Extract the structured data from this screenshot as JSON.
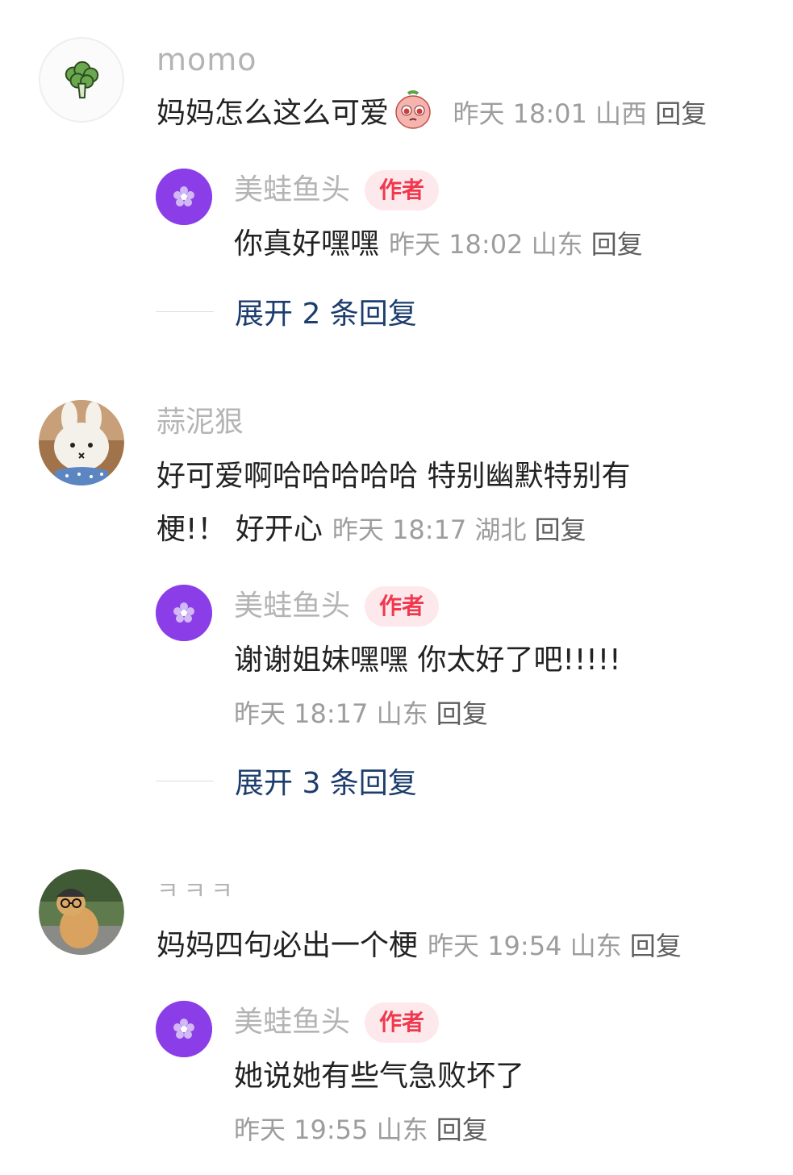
{
  "comments": [
    {
      "username": "momo",
      "text": "妈妈怎么这么可爱",
      "emoji": "face-with-pleading-eyes-emoji",
      "time": "昨天 18:01",
      "location": "山西",
      "reply_label": "回复",
      "avatar_icon": "broccoli-icon",
      "author_reply": {
        "username": "美蛙鱼头",
        "badge": "作者",
        "text": "你真好嘿嘿",
        "time": "昨天 18:02",
        "location": "山东",
        "reply_label": "回复"
      },
      "expand_label": "展开 2 条回复"
    },
    {
      "username": "蒜泥狠",
      "text_line1": "好可爱啊哈哈哈哈哈 特别幽默特别有",
      "text_line2": "梗!！ 好开心",
      "time": "昨天 18:17",
      "location": "湖北",
      "reply_label": "回复",
      "avatar_icon": "plush-bunny-icon",
      "author_reply": {
        "username": "美蛙鱼头",
        "badge": "作者",
        "text": "谢谢姐妹嘿嘿 你太好了吧!!!!!",
        "time": "昨天 18:17",
        "location": "山东",
        "reply_label": "回复"
      },
      "expand_label": "展开 3 条回复"
    },
    {
      "username": "ㅋㅋㅋ",
      "text": "妈妈四句必出一个梗",
      "time": "昨天 19:54",
      "location": "山东",
      "reply_label": "回复",
      "avatar_icon": "cat-photo-icon",
      "author_reply": {
        "username": "美蛙鱼头",
        "badge": "作者",
        "text": "她说她有些气急败坏了",
        "time": "昨天 19:55",
        "location": "山东",
        "reply_label": "回复"
      }
    }
  ],
  "colors": {
    "author_avatar_bg": "#8b3ee8",
    "badge_bg": "#fde9ec",
    "badge_text": "#f0384e",
    "expand_text": "#1c3d6d",
    "username": "#b4b4b4",
    "meta": "#9d9d9d"
  }
}
